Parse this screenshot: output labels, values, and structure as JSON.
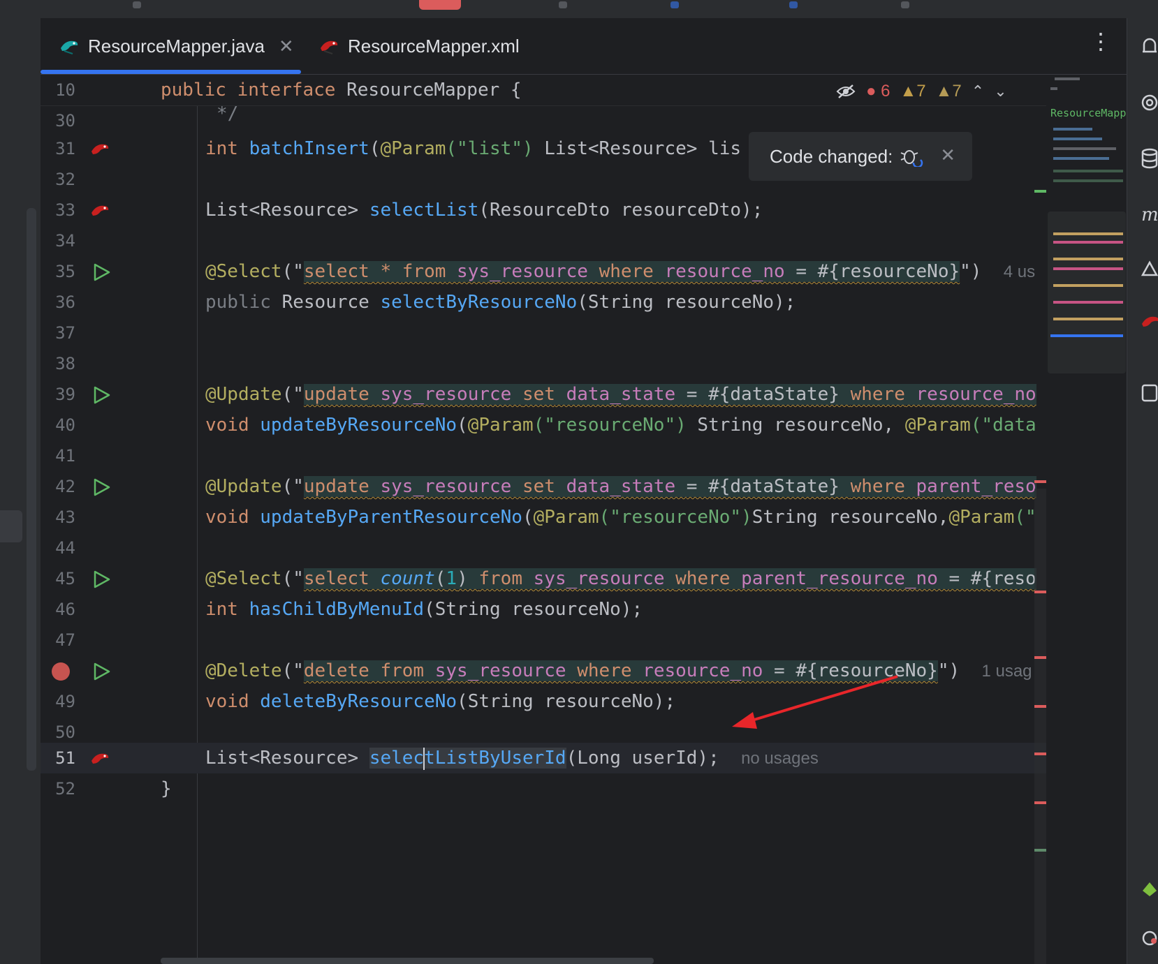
{
  "tabs": [
    {
      "label": "ResourceMapper.java",
      "active": true,
      "close": "✕"
    },
    {
      "label": "ResourceMapper.xml",
      "active": false
    }
  ],
  "more_menu": "⋮",
  "sticky": {
    "line": "10",
    "text_kw1": "public",
    "text_kw2": "interface",
    "text_rest": "ResourceMapper {"
  },
  "inspections": {
    "errors": "6",
    "warnings": "7",
    "weak_warnings": "7"
  },
  "popup": {
    "label": "Code changed:",
    "close": "✕"
  },
  "minimap_title": "ResourceMapper",
  "lines": {
    "l30": {
      "n": "30",
      "text": "*/"
    },
    "l31": {
      "n": "31",
      "kw": "int",
      "fn": "batchInsert",
      "a": "(",
      "an": "@Param",
      "s": "(\"list\")",
      "rest": " List<Resource> lis"
    },
    "l32": {
      "n": "32"
    },
    "l33": {
      "n": "33",
      "pre": "List<Resource> ",
      "fn": "selectList",
      "rest": "(ResourceDto resourceDto);"
    },
    "l34": {
      "n": "34"
    },
    "l35": {
      "n": "35",
      "an": "@Select",
      "a": "(\"",
      "sql1": "select",
      "sql2": " * ",
      "sql3": "from",
      "sql4": " sys_resource ",
      "sql5": "where",
      "sql6": " resource_no ",
      "sql7": "= #{resourceNo}",
      "end": "\")",
      "hint": "4 us"
    },
    "l36": {
      "n": "36",
      "kw": "public",
      "pre": " Resource ",
      "fn": "selectByResourceNo",
      "rest": "(String resourceNo);"
    },
    "l37": {
      "n": "37"
    },
    "l38": {
      "n": "38"
    },
    "l39": {
      "n": "39",
      "an": "@Update",
      "a": "(\"",
      "sql1": "update",
      "sql2": " sys_resource ",
      "sql3": "set",
      "sql4": " data_state ",
      "sql5": "= #{dataState} ",
      "sql6": "where",
      "sql7": " resource_no"
    },
    "l40": {
      "n": "40",
      "kw": "void",
      "fn": "updateByResourceNo",
      "a": "(",
      "an": "@Param",
      "s": "(\"resourceNo\")",
      "rest": " String resourceNo, ",
      "an2": "@Param",
      "s2": "(\"data"
    },
    "l41": {
      "n": "41"
    },
    "l42": {
      "n": "42",
      "an": "@Update",
      "a": "(\"",
      "sql1": "update",
      "sql2": " sys_resource ",
      "sql3": "set",
      "sql4": " data_state ",
      "sql5": "= #{dataState} ",
      "sql6": "where",
      "sql7": " parent_reso"
    },
    "l43": {
      "n": "43",
      "kw": "void",
      "fn": "updateByParentResourceNo",
      "a": "(",
      "an": "@Param",
      "s": "(\"resourceNo\")",
      "rest": "String resourceNo,",
      "an2": "@Param",
      "s2": "(\""
    },
    "l44": {
      "n": "44"
    },
    "l45": {
      "n": "45",
      "an": "@Select",
      "a": "(\"",
      "sql1": "select",
      "sql2": " ",
      "sql3": "count",
      "sql4": "(",
      "sql5": "1",
      "sql6": ") ",
      "sql7": "from",
      "sql8": " sys_resource ",
      "sql9": "where",
      "sql10": " parent_resource_no ",
      "sql11": "= #{reso"
    },
    "l46": {
      "n": "46",
      "kw": "int",
      "fn": "hasChildByMenuId",
      "rest": "(String resourceNo);"
    },
    "l47": {
      "n": "47"
    },
    "l48": {
      "n": "48",
      "an": "@Delete",
      "a": "(\"",
      "sql1": "delete",
      "sql2": " ",
      "sql3": "from",
      "sql4": " sys_resource ",
      "sql5": "where",
      "sql6": " resource_no ",
      "sql7": "= #{resourceNo}",
      "end": "\")",
      "hint": "1 usag"
    },
    "l49": {
      "n": "49",
      "kw": "void",
      "fn": "deleteByResourceNo",
      "rest": "(String resourceNo);"
    },
    "l50": {
      "n": "50"
    },
    "l51": {
      "n": "51",
      "pre": "List<Resource> ",
      "fn1": "selec",
      "fn2": "tListByUserId",
      "rest": "(Long userId);",
      "hint": "no usages"
    },
    "l52": {
      "n": "52",
      "text": "}"
    }
  },
  "colors": {
    "accent": "#3574f0",
    "error": "#db5c5c",
    "warning": "#c29e4a",
    "arrow": "#e8262a"
  },
  "icons": [
    "mybatis-bird-icon",
    "run-gutter-icon",
    "breakpoint-icon",
    "hide-eye-icon",
    "error-icon",
    "warning-icon",
    "chevron-up-icon",
    "chevron-down-icon",
    "bug-refresh-icon",
    "notifications-icon",
    "database-icon"
  ]
}
